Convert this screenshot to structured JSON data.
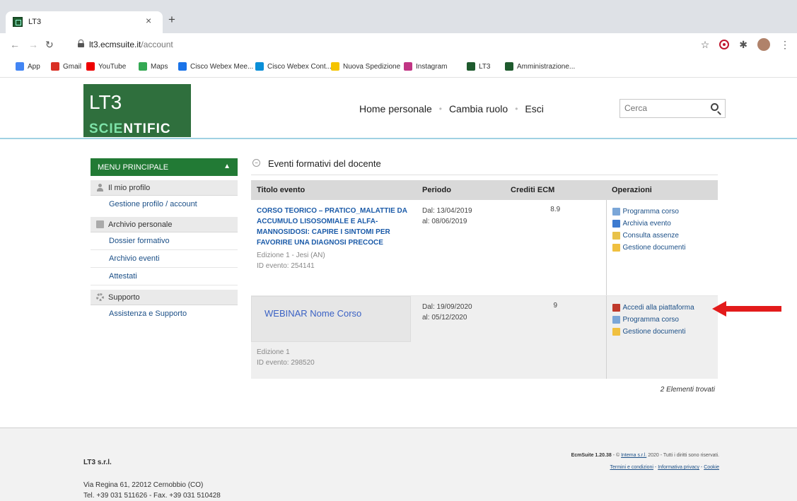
{
  "browser": {
    "tab_title": "LT3",
    "tab_close": "×",
    "new_tab": "+",
    "url_host": "lt3.ecmsuite.it",
    "url_path": "/account",
    "bookmarks": [
      {
        "label": "App",
        "icon": "apps-icon",
        "color": "#4285f4"
      },
      {
        "label": "Gmail",
        "icon": "gmail-icon",
        "color": "#d93025"
      },
      {
        "label": "YouTube",
        "icon": "youtube-icon",
        "color": "#e00"
      },
      {
        "label": "Maps",
        "icon": "maps-icon",
        "color": "#34a853"
      },
      {
        "label": "Cisco Webex Mee...",
        "icon": "webex-icon",
        "color": "#1a73e8"
      },
      {
        "label": "Cisco Webex Cont...",
        "icon": "cisco-icon",
        "color": "#0a8fd8"
      },
      {
        "label": "Nuova Spedizione",
        "icon": "shipping-icon",
        "color": "#f5c400"
      },
      {
        "label": "Instagram",
        "icon": "instagram-icon",
        "color": "#c13584"
      },
      {
        "label": "LT3",
        "icon": "lt3-icon",
        "color": "#1e5a2d"
      },
      {
        "label": "Amministrazione...",
        "icon": "lt3-icon",
        "color": "#1e5a2d"
      }
    ]
  },
  "header": {
    "logo_top": "LT3",
    "logo_sci_a": "SCIE",
    "logo_sci_b": "NTIFIC",
    "nav": [
      "Home personale",
      "Cambia ruolo",
      "Esci"
    ],
    "search_placeholder": "Cerca"
  },
  "sidebar": {
    "title": "MENU PRINCIPALE",
    "sections": [
      {
        "label": "Il mio profilo",
        "items": [
          "Gestione profilo / account"
        ]
      },
      {
        "label": "Archivio personale",
        "items": [
          "Dossier formativo",
          "Archivio eventi",
          "Attestati"
        ]
      },
      {
        "label": "Supporto",
        "items": [
          "Assistenza e Supporto"
        ]
      }
    ]
  },
  "main": {
    "panel_title": "Eventi formativi del docente",
    "columns": [
      "Titolo evento",
      "Periodo",
      "Crediti ECM",
      "Operazioni"
    ],
    "rows": [
      {
        "title": "CORSO TEORICO – PRATICO_MALATTIE DA ACCUMULO LISOSOMIALE E ALFA-MANNOSIDOSI: CAPIRE I SINTOMI PER FAVORIRE UNA DIAGNOSI PRECOCE",
        "edition": "Edizione 1 - Jesi (AN)",
        "event_id": "ID evento: 254141",
        "from": "Dal: 13/04/2019",
        "to": "al: 08/06/2019",
        "credits": "8.9",
        "ops": [
          {
            "label": "Programma corso",
            "color": "#7aa6d8"
          },
          {
            "label": "Archivia evento",
            "color": "#3d7bd0"
          },
          {
            "label": "Consulta assenze",
            "color": "#e8c24a"
          },
          {
            "label": "Gestione documenti",
            "color": "#f0c040"
          }
        ]
      },
      {
        "title": "WEBINAR Nome Corso",
        "edition": "Edizione 1",
        "event_id": "ID evento: 298520",
        "from": "Dal: 19/09/2020",
        "to": "al: 05/12/2020",
        "credits": "9",
        "ops": [
          {
            "label": "Accedi alla piattaforma",
            "color": "#c0392b"
          },
          {
            "label": "Programma corso",
            "color": "#7aa6d8"
          },
          {
            "label": "Gestione documenti",
            "color": "#f0c040"
          }
        ]
      }
    ],
    "count": "2 Elementi trovati"
  },
  "footer": {
    "company": "LT3 s.r.l.",
    "address": "Via Regina 61, 22012 Cernobbio (CO)",
    "phone": "Tel. +39 031 511626 - Fax. +39 031 510428",
    "version": "EcmSuite 1.20.38",
    "copy_mid": " - © ",
    "intema": "Intema s.r.l.",
    "copy_tail": " 2020 - Tutti i diritti sono riservati.",
    "terms": "Termini e condizioni",
    "privacy": "Informativa privacy",
    "cookie": "Cookie",
    "sep": " - "
  },
  "colors": {
    "accent_green": "#227a35",
    "link_blue": "#1a5aa8",
    "annotation_red": "#e31b1b"
  }
}
